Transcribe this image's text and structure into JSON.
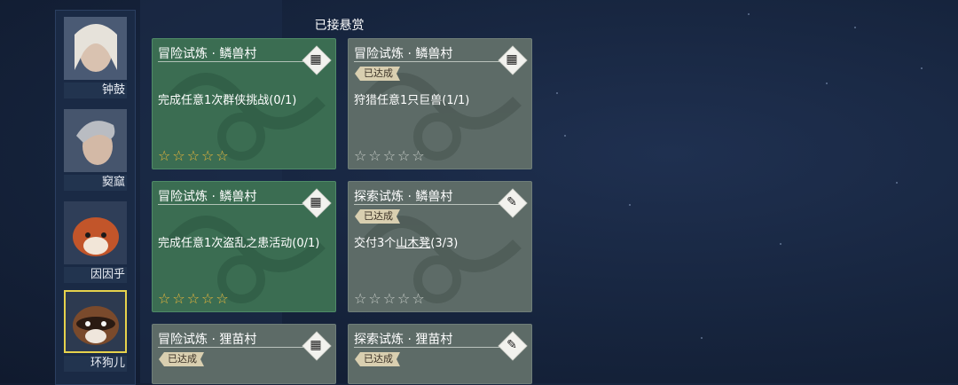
{
  "panel": {
    "title": "已接悬赏"
  },
  "characters": [
    {
      "name": "钟鼓",
      "selected": false
    },
    {
      "name": "窫窳",
      "selected": false
    },
    {
      "name": "因因乎",
      "selected": false
    },
    {
      "name": "环狗儿",
      "selected": true
    }
  ],
  "quests": [
    {
      "title": "冒险试炼 · 鳞兽村",
      "status": "",
      "desc": "完成任意1次群侠挑战(0/1)",
      "stars": "☆☆☆☆☆",
      "icon": "mask-icon",
      "icon_glyph": "▦"
    },
    {
      "title": "冒险试炼 · 鳞兽村",
      "status": "已达成",
      "desc": "狩猎任意1只巨兽(1/1)",
      "stars": "☆☆☆☆☆",
      "icon": "mask-icon",
      "icon_glyph": "▦"
    },
    {
      "title": "冒险试炼 · 鳞兽村",
      "status": "",
      "desc": "完成任意1次盗乱之患活动(0/1)",
      "stars": "☆☆☆☆☆",
      "icon": "mask-icon",
      "icon_glyph": "▦"
    },
    {
      "title": "探索试炼 · 鳞兽村",
      "status": "已达成",
      "desc_prefix": "交付3个",
      "desc_item": "山木凳",
      "desc_suffix": "(3/3)",
      "stars": "☆☆☆☆☆",
      "icon": "scroll-icon",
      "icon_glyph": "✎"
    },
    {
      "title": "冒险试炼 · 狸苗村",
      "status": "已达成",
      "desc": "",
      "stars": "",
      "icon": "mask-icon",
      "icon_glyph": "▦"
    },
    {
      "title": "探索试炼 · 狸苗村",
      "status": "已达成",
      "desc": "",
      "stars": "",
      "icon": "scroll-icon",
      "icon_glyph": "✎"
    }
  ],
  "colors": {
    "active_card": "#3b6d52",
    "done_card": "#5d6b67",
    "star_gold": "#f0b93a",
    "selected_border": "#e6d24c"
  }
}
